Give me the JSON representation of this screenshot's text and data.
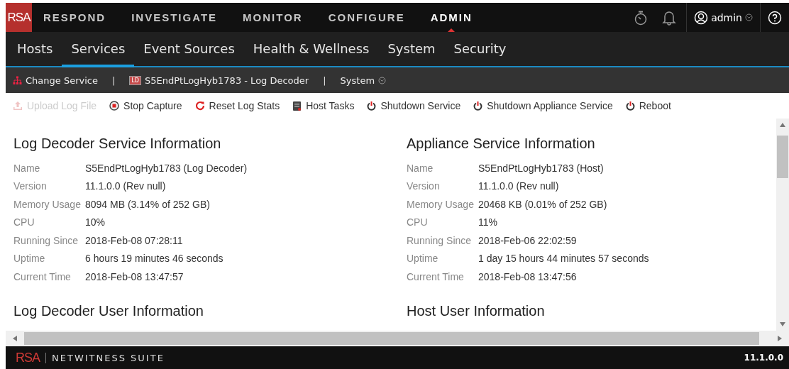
{
  "top_nav": {
    "logo": "RSA",
    "items": [
      {
        "label": "RESPOND",
        "selected": false
      },
      {
        "label": "INVESTIGATE",
        "selected": false
      },
      {
        "label": "MONITOR",
        "selected": false
      },
      {
        "label": "CONFIGURE",
        "selected": false
      },
      {
        "label": "ADMIN",
        "selected": true
      }
    ],
    "user": "admin"
  },
  "sub_nav": [
    {
      "label": "Hosts",
      "selected": false
    },
    {
      "label": "Services",
      "selected": true
    },
    {
      "label": "Event Sources",
      "selected": false
    },
    {
      "label": "Health & Wellness",
      "selected": false
    },
    {
      "label": "System",
      "selected": false
    },
    {
      "label": "Security",
      "selected": false
    }
  ],
  "breadcrumb": {
    "change_service": "Change Service",
    "separator_1": "|",
    "service_badge": "LD",
    "service": "S5EndPtLogHyb1783 - Log Decoder",
    "separator_2": "|",
    "view": "System"
  },
  "toolbar": [
    {
      "kind": "upload",
      "label": "Upload Log File",
      "disabled": true
    },
    {
      "kind": "stop",
      "label": "Stop Capture",
      "disabled": false
    },
    {
      "kind": "reset",
      "label": "Reset Log Stats",
      "disabled": false
    },
    {
      "kind": "tasks",
      "label": "Host Tasks",
      "disabled": false
    },
    {
      "kind": "power",
      "label": "Shutdown Service",
      "disabled": false
    },
    {
      "kind": "power",
      "label": "Shutdown Appliance Service",
      "disabled": false
    },
    {
      "kind": "power",
      "label": "Reboot",
      "disabled": false
    }
  ],
  "sections": [
    {
      "title": "Log Decoder Service Information",
      "rows": [
        {
          "label": "Name",
          "value": "S5EndPtLogHyb1783 (Log Decoder)"
        },
        {
          "label": "Version",
          "value": "11.1.0.0 (Rev null)"
        },
        {
          "label": "Memory Usage",
          "value": "8094 MB (3.14% of 252 GB)"
        },
        {
          "label": "CPU",
          "value": "10%"
        },
        {
          "label": "Running Since",
          "value": "2018-Feb-08 07:28:11"
        },
        {
          "label": "Uptime",
          "value": "6 hours 19 minutes 46 seconds"
        },
        {
          "label": "Current Time",
          "value": "2018-Feb-08 13:47:57"
        }
      ],
      "next_title": "Log Decoder User Information"
    },
    {
      "title": "Appliance Service Information",
      "rows": [
        {
          "label": "Name",
          "value": "S5EndPtLogHyb1783 (Host)"
        },
        {
          "label": "Version",
          "value": "11.1.0.0 (Rev null)"
        },
        {
          "label": "Memory Usage",
          "value": "20468 KB (0.01% of 252 GB)"
        },
        {
          "label": "CPU",
          "value": "11%"
        },
        {
          "label": "Running Since",
          "value": "2018-Feb-06 22:02:59"
        },
        {
          "label": "Uptime",
          "value": "1 day 15 hours 44 minutes 57 seconds"
        },
        {
          "label": "Current Time",
          "value": "2018-Feb-08 13:47:56"
        }
      ],
      "next_title": "Host User Information"
    }
  ],
  "footer": {
    "logo": "RSA",
    "product": "NETWITNESS SUITE",
    "version": "11.1.0.0"
  }
}
